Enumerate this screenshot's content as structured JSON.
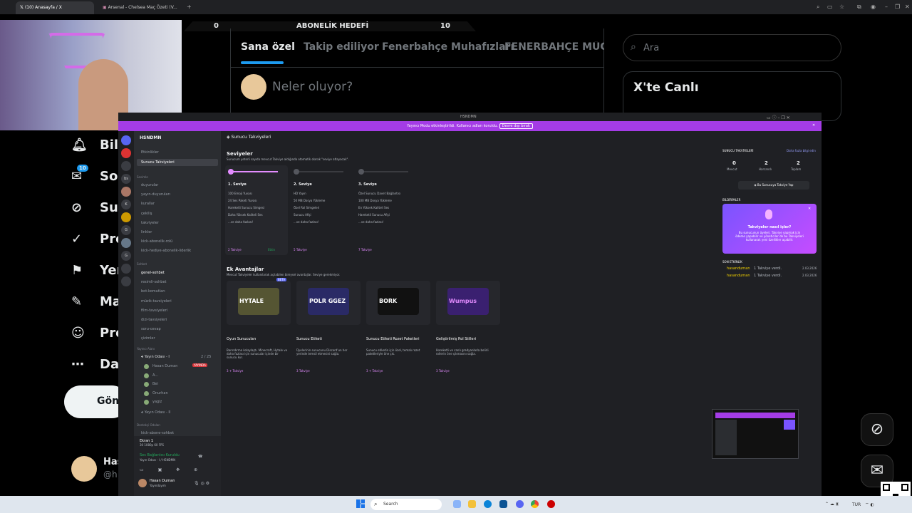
{
  "browser": {
    "tabs": [
      {
        "label": "(10) Anasayfa / X"
      },
      {
        "label": "Arsenal - Chelsea Maç Özeti (V..."
      }
    ],
    "new_tab": "+"
  },
  "stream": {
    "goal_left": "0",
    "goal_title": "ABONELİK HEDEFİ",
    "goal_right": "10"
  },
  "x": {
    "tabs": [
      "Sana özel",
      "Takip ediliyor",
      "Fenerbahçe Muhafızları",
      "FENERBAHÇE MÜCADE"
    ],
    "compose_placeholder": "Neler oluyor?",
    "search_placeholder": "Ara",
    "live_title": "X'te Canlı",
    "nav": [
      {
        "label": "Bild",
        "icon": "bell-icon"
      },
      {
        "label": "Soh",
        "icon": "mail-icon",
        "badge": "10"
      },
      {
        "label": "Sup",
        "icon": "grok-icon"
      },
      {
        "label": "Pre",
        "icon": "verified-icon"
      },
      {
        "label": "Yer",
        "icon": "bookmark-icon"
      },
      {
        "label": "Ma",
        "icon": "edit-icon"
      },
      {
        "label": "Pro",
        "icon": "profile-icon"
      },
      {
        "label": "Da",
        "icon": "more-icon"
      }
    ],
    "post_button": "Gön",
    "profile_name": "Has",
    "profile_handle": "@h"
  },
  "discord": {
    "window_title": "HSNDMN",
    "banner_text": "Yayıncı Modu etkinleştirildi. Kullanıcı adları koruldu.",
    "banner_button": "Devre dışı bırak",
    "server_name": "HSNDMN",
    "channels_top": [
      "Etkinlikler",
      "Sunucu Takviyeleri"
    ],
    "cat_1": "Sesimle",
    "channels_1": [
      "duyurular",
      "yayın-duyuruları",
      "kurallar",
      "çekiliş",
      "takviyeler",
      "linkler",
      "kick-abonelik-rolü",
      "kick-hediye-abonelik-liderlik"
    ],
    "cat_2": "Sohbet",
    "channels_2": [
      "genel-sohbet",
      "resimli-sohbet",
      "bot-komutları",
      "müzik-tavsiyeleri",
      "film-tavsiyeleri",
      "dizi-tavsiyeleri",
      "soru-cevap",
      "çizimler"
    ],
    "cat_3": "Yayıncı Alanı",
    "voice_1": "Yayın Odası - I",
    "voice_1_count": "2 / 25",
    "voice_users": [
      "Hasan Duman",
      "A...",
      "Bei",
      "Onurhan",
      "yagiz"
    ],
    "live_badge": "YAYINDA",
    "voice_2": "Yayın Odası - II",
    "cat_4": "Destekçi Odaları",
    "channel_last": "kick-abone-sohbet",
    "screen_label": "Ekran 1",
    "screen_sub": "30 1080p 60 FPS",
    "voice_connected": "Ses Bağlantısı Kuruldu",
    "voice_connected_sub": "Yayın Odası - I / HSNDMN",
    "user_name": "Hasan Duman",
    "user_status": "Yayındayım",
    "header_title": "Sunucu Takviyeleri",
    "levels_title": "Seviyeler",
    "levels_sub": "Sunucum yeterli sayıda mevcut Takviye aldığında otomatik olarak \"seviye atlayacak\".",
    "levels": [
      {
        "name": "1. Seviye",
        "perks": [
          "100 Emoji Yuvası",
          "24 Ses Paketi Yuvası",
          "Hareketli Sunucu Simgesi",
          "Daha Yüksek Kaliteli Ses",
          "...ve daha fazlası!"
        ],
        "boosts": "2 Takviye",
        "status": "Etkin"
      },
      {
        "name": "2. Seviye",
        "perks": [
          "HD Yayın",
          "50 MB Dosya Yükleme",
          "Özel Rol Simgeleri",
          "Sunucu Afişi",
          "...ve daha fazlası!"
        ],
        "boosts": "5 Takviye"
      },
      {
        "name": "3. Seviye",
        "perks": [
          "Özel Sunucu Davet Bağlantısı",
          "100 MB Dosya Yükleme",
          "En Yüksek Kaliteli Ses",
          "Hareketli Sunucu Afişi",
          "...ve daha fazlası!"
        ],
        "boosts": "7 Takviye"
      }
    ],
    "extras_title": "Ek Avantajlar",
    "extras_sub": "Mevcut Takviyeler kullanılarak açılabilen bireysel avantajlar. Seviye gerekmiyor.",
    "extras": [
      {
        "art": "HYTALE",
        "badge": "BETA",
        "name": "Oyun Sunucuları",
        "desc": "Barındırma kolaylaştı. Minecraft, Hytale ve daha fazlası için sunucular içinde bir sunucu kur.",
        "cost": "3 + Takviye"
      },
      {
        "art": "POLR GGEZ",
        "name": "Sunucu Etiketi",
        "desc": "Üyelerinin sunucunu Discord'un her yerinde temsil etmesini sağla.",
        "cost": "3 Takviye"
      },
      {
        "art": "BORK",
        "name": "Sunucu Etiketi Rozet Paketleri",
        "desc": "Sunucu etiketin için özel, temalı rozet paketleriyle öne çık.",
        "cost": "3 + Takviye"
      },
      {
        "art": "Wumpus",
        "name": "Geliştirilmiş Rol Stilleri",
        "desc": "Hareketli ve canlı gradyanlarla belirli rollerin öne çıkmasını sağla.",
        "cost": "3 Takviye"
      }
    ],
    "side_title": "SUNUCU TAKVİYELERİ",
    "side_link": "Daha fazla bilgi edin",
    "stats": [
      {
        "value": "0",
        "label": "Mevcut"
      },
      {
        "value": "2",
        "label": "Harcandı"
      },
      {
        "value": "2",
        "label": "Toplam"
      }
    ],
    "boost_button": "Bu Sunucuya Takviye Yap",
    "info_title": "BİLDİRİMLER",
    "promo_title": "Takviyeler nasıl işler?",
    "promo_text": "Bu sunucunun üyeleri, Takviye yapmak için ödeme yapabilir ve yöneticiler de bu Takviyeleri kullanarak yeni özellikler açabilir.",
    "activity_title": "SON ETKİNLİK",
    "activity": [
      {
        "user": "hasanduman",
        "text": "1 Takviye verdi.",
        "date": "2.03.2026"
      },
      {
        "user": "hasanduman",
        "text": "1 Takviye verdi.",
        "date": "2.03.2026"
      }
    ]
  },
  "taskbar": {
    "search_placeholder": "Search",
    "lang": "TUR"
  },
  "colors": {
    "discord_purple": "#a43ce6",
    "boost_pink": "#e38cff",
    "x_bg": "#000000"
  }
}
